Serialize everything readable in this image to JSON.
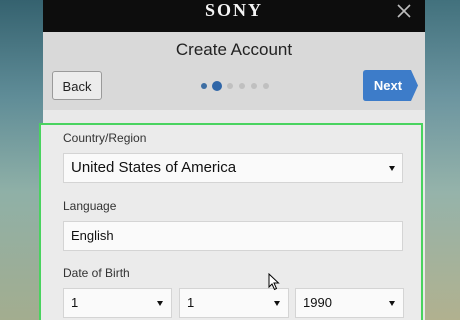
{
  "brand": "SONY",
  "title": "Create Account",
  "nav": {
    "back_label": "Back",
    "next_label": "Next",
    "next_color": "#3d7cc9"
  },
  "progress": {
    "total_steps": 6,
    "current_step": 2
  },
  "form": {
    "country": {
      "label": "Country/Region",
      "value": "United States of America"
    },
    "language": {
      "label": "Language",
      "value": "English"
    },
    "dob": {
      "label": "Date of Birth",
      "month": "1",
      "day": "1",
      "year": "1990"
    }
  },
  "colors": {
    "focus_outline": "#49d35f",
    "titlebar": "#0d0d0d"
  }
}
